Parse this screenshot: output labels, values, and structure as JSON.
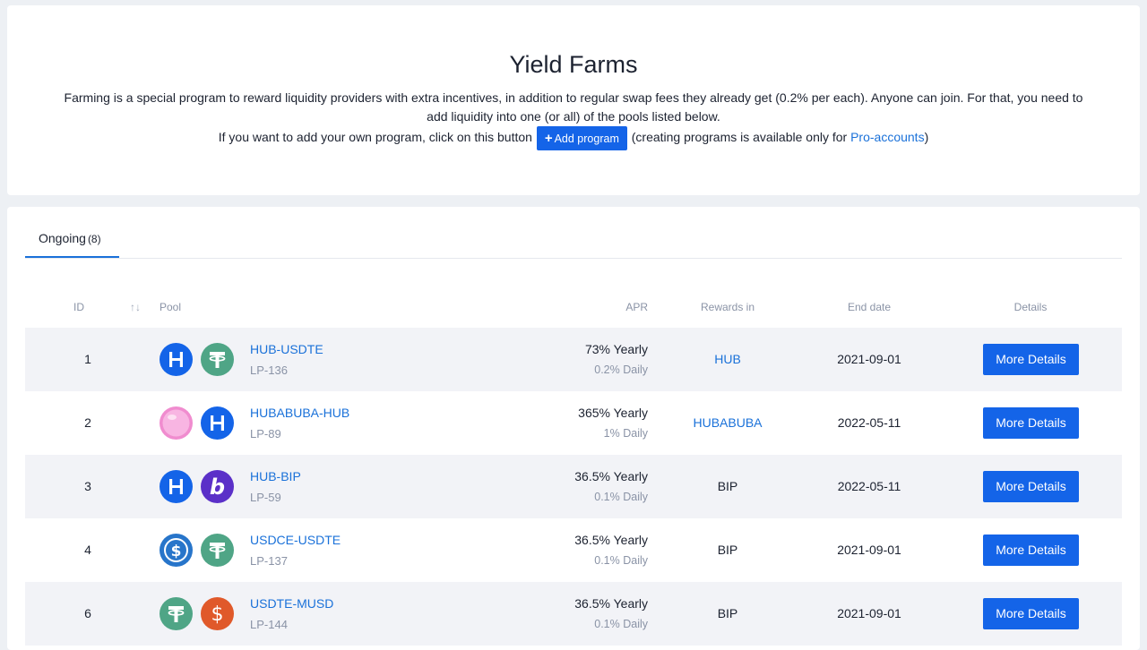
{
  "header": {
    "title": "Yield Farms",
    "description": "Farming is a special program to reward liquidity providers with extra incentives, in addition to regular swap fees they already get (0.2% per each). Anyone can join. For that, you need to add liquidity into one (or all) of the pools listed below.",
    "own_program_prefix": "If you want to add your own program, click on this button",
    "add_program_label": "Add program",
    "own_program_suffix": "(creating programs is available only for",
    "pro_accounts_link": "Pro-accounts",
    "closing_paren": ")"
  },
  "tabs": [
    {
      "label": "Ongoing",
      "count": "(8)"
    }
  ],
  "table": {
    "columns": {
      "id": "ID",
      "sort_icon": "↑↓",
      "pool": "Pool",
      "apr": "APR",
      "rewards": "Rewards in",
      "end_date": "End date",
      "details": "Details"
    },
    "rows": [
      {
        "id": "1",
        "pair": "HUB-USDTE",
        "lp": "LP-136",
        "yearly": "73% Yearly",
        "daily": "0.2% Daily",
        "rewards": "HUB",
        "rewards_link": true,
        "end_date": "2021-09-01",
        "details": "More Details",
        "icons": [
          "hub-icon",
          "tether-icon"
        ]
      },
      {
        "id": "2",
        "pair": "HUBABUBA-HUB",
        "lp": "LP-89",
        "yearly": "365% Yearly",
        "daily": "1% Daily",
        "rewards": "HUBABUBA",
        "rewards_link": true,
        "end_date": "2022-05-11",
        "details": "More Details",
        "icons": [
          "bubblegum-icon",
          "hub-icon"
        ]
      },
      {
        "id": "3",
        "pair": "HUB-BIP",
        "lp": "LP-59",
        "yearly": "36.5% Yearly",
        "daily": "0.1% Daily",
        "rewards": "BIP",
        "rewards_link": false,
        "end_date": "2022-05-11",
        "details": "More Details",
        "icons": [
          "hub-icon",
          "bip-icon"
        ]
      },
      {
        "id": "4",
        "pair": "USDCE-USDTE",
        "lp": "LP-137",
        "yearly": "36.5% Yearly",
        "daily": "0.1% Daily",
        "rewards": "BIP",
        "rewards_link": false,
        "end_date": "2021-09-01",
        "details": "More Details",
        "icons": [
          "usdc-icon",
          "tether-icon"
        ]
      },
      {
        "id": "6",
        "pair": "USDTE-MUSD",
        "lp": "LP-144",
        "yearly": "36.5% Yearly",
        "daily": "0.1% Daily",
        "rewards": "BIP",
        "rewards_link": false,
        "end_date": "2021-09-01",
        "details": "More Details",
        "icons": [
          "tether-icon",
          "musd-icon"
        ]
      }
    ]
  },
  "colors": {
    "primary": "#1464e8",
    "link": "#1a71d9",
    "hub": "#1464e8",
    "tether": "#4fa586",
    "bubblegum": "#f5a6d8",
    "bip": "#5b30c8",
    "usdc": "#2775ca",
    "musd": "#e0592a"
  }
}
